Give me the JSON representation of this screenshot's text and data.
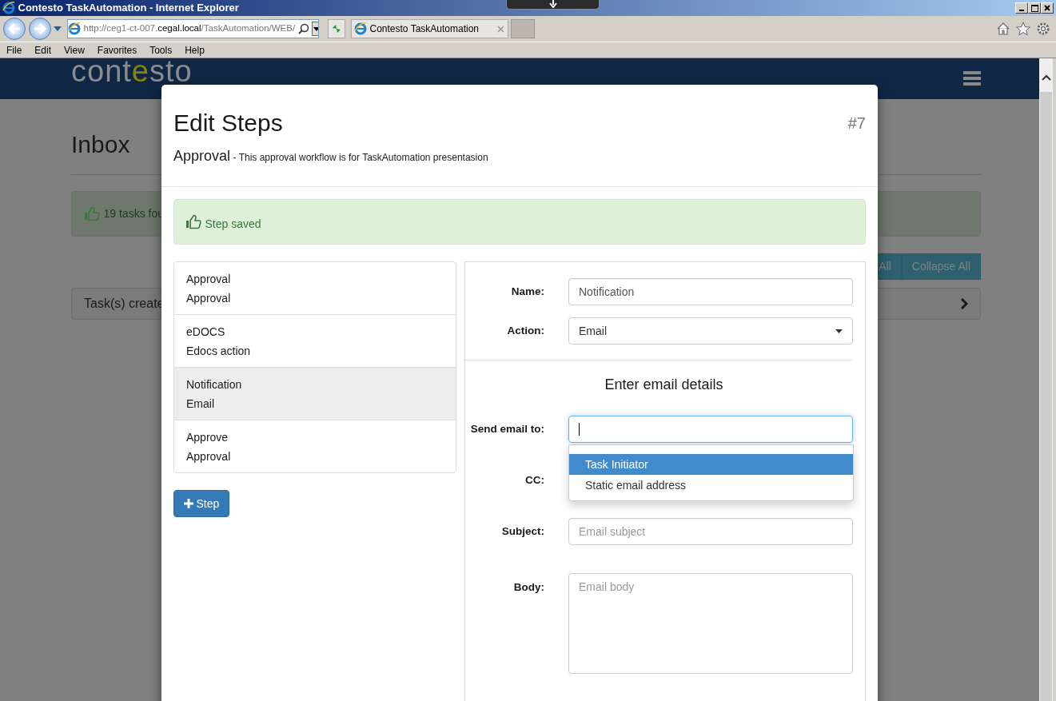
{
  "browser": {
    "title": "Contesto TaskAutomation - Internet Explorer",
    "address": {
      "host_start": "http://ceg1-ct-007.",
      "domain": "cegal.local",
      "path": "/TaskAutomation/WEB/"
    },
    "tab": "Contesto TaskAutomation",
    "menu": [
      "File",
      "Edit",
      "View",
      "Favorites",
      "Tools",
      "Help"
    ]
  },
  "page": {
    "logo": [
      {
        "text": "cont",
        "color": "#8c8c8c"
      },
      {
        "text": "e",
        "color": "#8a8400"
      },
      {
        "text": "sto",
        "color": "#8c8c8c"
      }
    ],
    "heading": "Inbox",
    "alert": "19 tasks fou",
    "buttons": [
      "All",
      "Collapse All"
    ],
    "panel_title": "Task(s) create"
  },
  "modal": {
    "title": "Edit Steps",
    "number": "#7",
    "workflow_name": "Approval",
    "workflow_description": "- This approval workflow is for TaskAutomation presentasion",
    "alert": "Step saved",
    "steps": [
      {
        "name": "Approval",
        "action": "Approval",
        "selected": false
      },
      {
        "name": "eDOCS",
        "action": "Edocs action",
        "selected": false
      },
      {
        "name": "Notification",
        "action": "Email",
        "selected": true
      },
      {
        "name": "Approve",
        "action": "Approval",
        "selected": false
      }
    ],
    "add_step_button": "Step",
    "form": {
      "name_label": "Name:",
      "name_value": "Notification",
      "action_label": "Action:",
      "action_value": "Email",
      "section_title": "Enter email details",
      "send_to_label": "Send email to:",
      "send_to_options": [
        {
          "label": "Task Initiator",
          "selected": true
        },
        {
          "label": "Static email address",
          "selected": false
        }
      ],
      "cc_label": "CC:",
      "subject_label": "Subject:",
      "subject_placeholder": "Email subject",
      "body_label": "Body:",
      "body_placeholder": "Email body"
    }
  }
}
